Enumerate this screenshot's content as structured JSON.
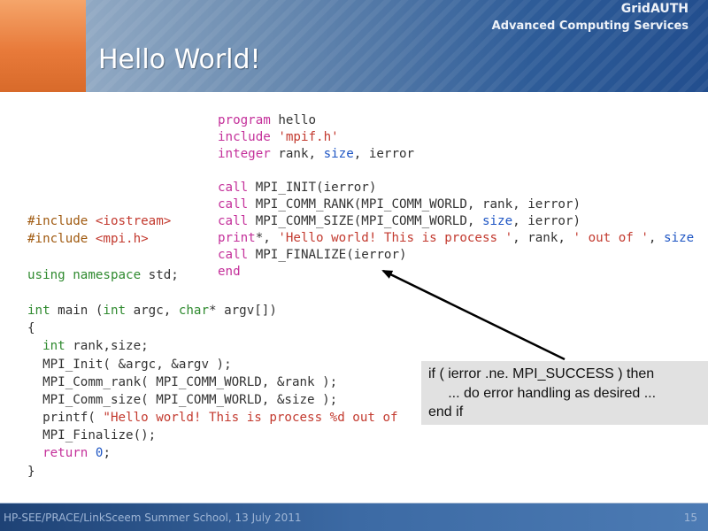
{
  "header": {
    "title": "Hello World!",
    "brand_line1": "GridAUTH",
    "brand_line2": "Advanced Computing Services"
  },
  "fortran_code": {
    "l1_kw": "program",
    "l1_rest": " hello",
    "l2_kw": "include",
    "l2_str": " 'mpif.h'",
    "l3_kw": "integer",
    "l3_a": " rank, ",
    "l3_b": "size",
    "l3_c": ", ierror",
    "l5_kw": "call",
    "l5_rest": " MPI_INIT(ierror)",
    "l6_kw": "call",
    "l6_rest": " MPI_COMM_RANK(MPI_COMM_WORLD, rank, ierror)",
    "l7_kw": "call",
    "l7_a": " MPI_COMM_SIZE(MPI_COMM_WORLD, ",
    "l7_b": "size",
    "l7_c": ", ierror)",
    "l8_kw": "print",
    "l8_a": "*, ",
    "l8_str1": "'Hello world! This is process '",
    "l8_b": ", rank, ",
    "l8_str2": "' out of '",
    "l8_c": ", ",
    "l8_d": "size",
    "l9_kw": "call",
    "l9_rest": " MPI_FINALIZE(ierror)",
    "l10_kw": "end"
  },
  "cpp_code": {
    "l1_pp": "#include ",
    "l1_str": "<iostream>",
    "l2_pp": "#include ",
    "l2_str": "<mpi.h>",
    "l4_kw": "using namespace",
    "l4_rest": " std;",
    "l6_typ1": "int",
    "l6_a": " main (",
    "l6_typ2": "int",
    "l6_b": " argc, ",
    "l6_typ3": "char",
    "l6_c": "* argv[])",
    "l7": "{",
    "l8_typ": "  int",
    "l8_rest": " rank,size;",
    "l9": "  MPI_Init( &argc, &argv );",
    "l10": "  MPI_Comm_rank( MPI_COMM_WORLD, &rank );",
    "l11": "  MPI_Comm_size( MPI_COMM_WORLD, &size );",
    "l12_a": "  printf( ",
    "l12_str": "\"Hello world! This is process %d out of",
    "l13": "  MPI_Finalize();",
    "l14_kw": "  return",
    "l14_num": " 0",
    "l14_rest": ";",
    "l15": "}"
  },
  "callout": {
    "line1": "if ( ierror .ne. MPI_SUCCESS ) then",
    "line2": "     ... do error handling as desired ...",
    "line3": "end if"
  },
  "footer": {
    "text": "HP-SEE/PRACE/LinkSceem Summer School, 13 July 2011",
    "page_number": "15"
  },
  "colors": {
    "header_orange": "#e87a3a",
    "header_blue": "#224e8e",
    "footer_blue": "#3c6aa4",
    "callout_bg": "#e1e1e1",
    "keyword": "#c4309a",
    "string": "#c33a2f"
  }
}
